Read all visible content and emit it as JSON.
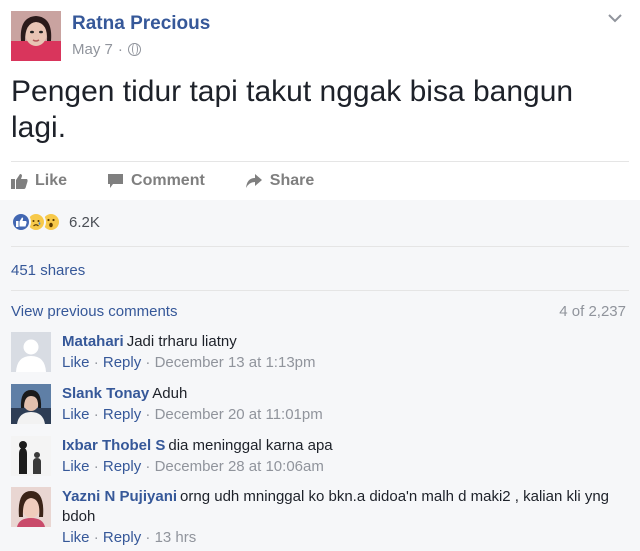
{
  "post": {
    "author": "Ratna Precious",
    "date": "May 7",
    "dot": "·",
    "text": "Pengen tidur tapi takut nggak bisa bangun lagi."
  },
  "actions": {
    "like": "Like",
    "comment": "Comment",
    "share": "Share"
  },
  "reactions": {
    "count": "6.2K",
    "icons": [
      "like-icon",
      "sad-icon",
      "wow-icon"
    ]
  },
  "shares": "451 shares",
  "comments_header": {
    "view_previous": "View previous comments",
    "count": "4 of 2,237"
  },
  "comments": [
    {
      "name": "Matahari",
      "text": "Jadi trharu liatny",
      "like": "Like",
      "reply": "Reply",
      "sep": "·",
      "time": "December 13 at 1:13pm"
    },
    {
      "name": "Slank Tonay",
      "text": "Aduh",
      "like": "Like",
      "reply": "Reply",
      "sep": "·",
      "time": "December 20 at 11:01pm"
    },
    {
      "name": "Ixbar Thobel S",
      "text": "dia meninggal karna apa",
      "like": "Like",
      "reply": "Reply",
      "sep": "·",
      "time": "December 28 at 10:06am"
    },
    {
      "name": "Yazni N Pujiyani",
      "text": "orng udh mninggal ko bkn.a didoa'n malh d maki2 , kalian kli yng bdoh",
      "like": "Like",
      "reply": "Reply",
      "sep": "·",
      "time": "13 hrs"
    }
  ],
  "colors": {
    "link": "#365899",
    "muted": "#90949c",
    "text": "#1d2129",
    "background": "#f6f7f9"
  }
}
